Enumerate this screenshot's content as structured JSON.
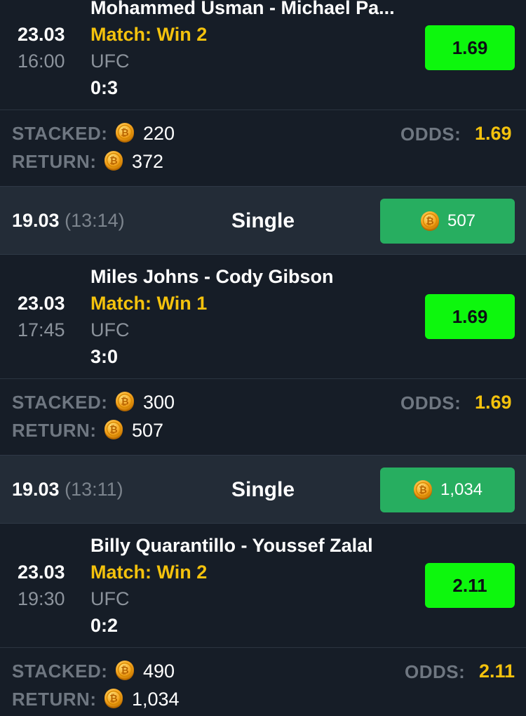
{
  "labels": {
    "stacked": "STACKED:",
    "return": "RETURN:",
    "odds": "ODDS:"
  },
  "colors": {
    "background": "#161d27",
    "slip_bar": "#232c37",
    "odd_button": "#0df70d",
    "return_button": "#27ae60",
    "accent_yellow": "#f4c20d",
    "muted_text": "#8c939c"
  },
  "coin_icon": "bitcoin-coin-icon",
  "bets": [
    {
      "teams": "Mohammed Usman - Michael Pa...",
      "date": "23.03",
      "time": "16:00",
      "market": "Match: Win 2",
      "league": "UFC",
      "score": "0:3",
      "odd": "1.69",
      "stacked": "220",
      "return": "372",
      "odds": "1.69"
    },
    {
      "slip_date": "19.03",
      "slip_time": "(13:14)",
      "slip_type": "Single",
      "slip_return": "507",
      "teams": "Miles Johns - Cody Gibson",
      "date": "23.03",
      "time": "17:45",
      "market": "Match: Win 1",
      "league": "UFC",
      "score": "3:0",
      "odd": "1.69",
      "stacked": "300",
      "return": "507",
      "odds": "1.69"
    },
    {
      "slip_date": "19.03",
      "slip_time": "(13:11)",
      "slip_type": "Single",
      "slip_return": "1,034",
      "teams": "Billy Quarantillo - Youssef Zalal",
      "date": "23.03",
      "time": "19:30",
      "market": "Match: Win 2",
      "league": "UFC",
      "score": "0:2",
      "odd": "2.11",
      "stacked": "490",
      "return": "1,034",
      "odds": "2.11"
    }
  ]
}
